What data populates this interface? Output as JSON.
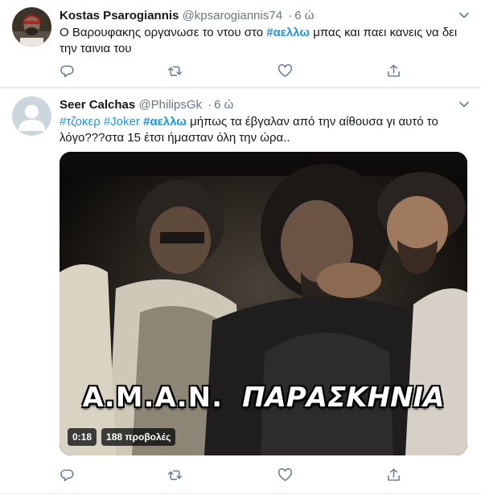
{
  "tweets": [
    {
      "name": "Kostas Psarogiannis",
      "handle": "@kpsarogiannis74",
      "dot": "·",
      "time": "6 ώ",
      "text_before": "Ο Βαρουφακης οργανωσε το ντου στο ",
      "hashtag": "#αελλω",
      "text_after": " μπας και παει κανεις να δει την ταινια του"
    },
    {
      "name": "Seer Calchas",
      "handle": "@PhilipsGk",
      "dot": "·",
      "time": "6 ώ",
      "hashtag1": "#τζοκερ",
      "hashtag2": "#Joker",
      "hashtag3": "#αελλω",
      "text_after": " μήπως τα έβγαλαν από την αίθουσα γι αυτό το λόγο???στα 15 έτσι ήμασταν όλη την ώρα..",
      "video": {
        "caption_left": "Α.Μ.Α.Ν.",
        "caption_right": "ΠΑΡΑΣΚΗΝΙΑ",
        "duration": "0:18",
        "views": "188 προβολές"
      }
    }
  ],
  "icons": {
    "reply": "reply-icon",
    "retweet": "retweet-icon",
    "like": "heart-icon",
    "share": "share-icon",
    "caret": "chevron-down-icon"
  },
  "colors": {
    "link": "#1b95e0",
    "secondary": "#657786",
    "border": "#e6ecf0"
  }
}
